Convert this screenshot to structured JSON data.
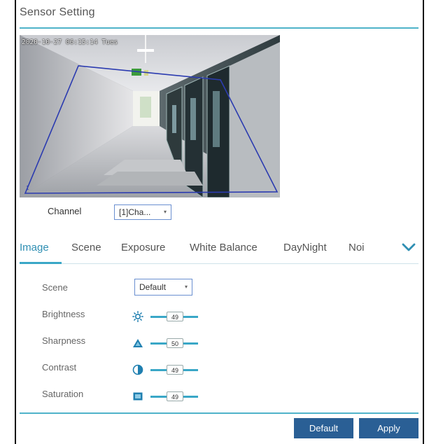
{
  "page": {
    "title": "Sensor Setting"
  },
  "preview": {
    "osd_text": "2020-10-27 06:15:14 Tues",
    "region_number": "1"
  },
  "channel": {
    "label": "Channel",
    "selected": "[1]Cha...",
    "arrow": "▾"
  },
  "tabs": [
    {
      "label": "Image",
      "active": true
    },
    {
      "label": "Scene",
      "active": false
    },
    {
      "label": "Exposure",
      "active": false
    },
    {
      "label": "White Balance",
      "active": false
    },
    {
      "label": "DayNight",
      "active": false
    },
    {
      "label": "Noi",
      "active": false
    }
  ],
  "settings": {
    "scene": {
      "label": "Scene",
      "value": "Default",
      "arrow": "▾"
    },
    "brightness": {
      "label": "Brightness",
      "value": "49",
      "icon": "sun-icon"
    },
    "sharpness": {
      "label": "Sharpness",
      "value": "50",
      "icon": "triangle-icon"
    },
    "contrast": {
      "label": "Contrast",
      "value": "49",
      "icon": "half-circle-icon"
    },
    "saturation": {
      "label": "Saturation",
      "value": "49",
      "icon": "square-icon"
    }
  },
  "buttons": {
    "default": "Default",
    "apply": "Apply"
  },
  "colors": {
    "accent": "#3aa7c7",
    "button": "#2a5f95",
    "region": "#2b3bb0"
  }
}
